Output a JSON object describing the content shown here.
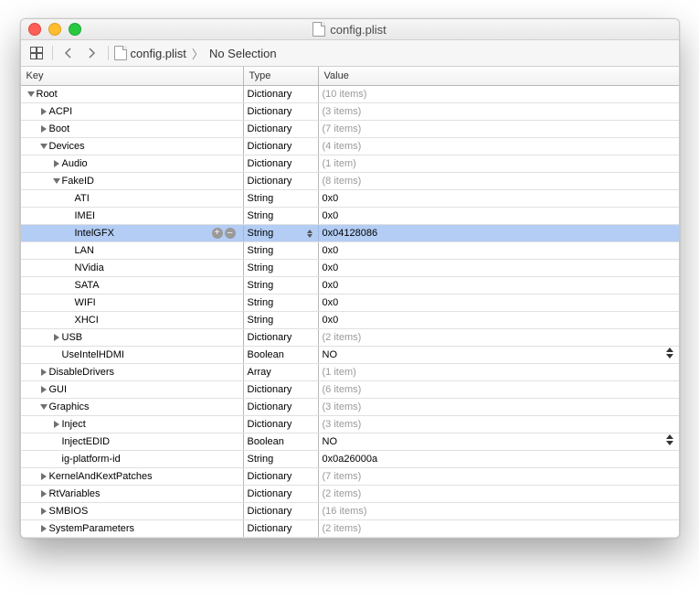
{
  "window": {
    "title": "config.plist"
  },
  "toolbar": {
    "breadcrumb_file": "config.plist",
    "breadcrumb_selection": "No Selection"
  },
  "headers": {
    "key": "Key",
    "type": "Type",
    "value": "Value"
  },
  "rows": [
    {
      "indent": 0,
      "disclosure": "down",
      "key": "Root",
      "type": "Dictionary",
      "value": "(10 items)",
      "muted": true
    },
    {
      "indent": 1,
      "disclosure": "right",
      "key": "ACPI",
      "type": "Dictionary",
      "value": "(3 items)",
      "muted": true
    },
    {
      "indent": 1,
      "disclosure": "right",
      "key": "Boot",
      "type": "Dictionary",
      "value": "(7 items)",
      "muted": true
    },
    {
      "indent": 1,
      "disclosure": "down",
      "key": "Devices",
      "type": "Dictionary",
      "value": "(4 items)",
      "muted": true
    },
    {
      "indent": 2,
      "disclosure": "right",
      "key": "Audio",
      "type": "Dictionary",
      "value": "(1 item)",
      "muted": true
    },
    {
      "indent": 2,
      "disclosure": "down",
      "key": "FakeID",
      "type": "Dictionary",
      "value": "(8 items)",
      "muted": true
    },
    {
      "indent": 3,
      "disclosure": "none",
      "key": "ATI",
      "type": "String",
      "value": "0x0"
    },
    {
      "indent": 3,
      "disclosure": "none",
      "key": "IMEI",
      "type": "String",
      "value": "0x0"
    },
    {
      "indent": 3,
      "disclosure": "none",
      "key": "IntelGFX",
      "type": "String",
      "value": "0x04128086",
      "selected": true,
      "type_arrows": true
    },
    {
      "indent": 3,
      "disclosure": "none",
      "key": "LAN",
      "type": "String",
      "value": "0x0"
    },
    {
      "indent": 3,
      "disclosure": "none",
      "key": "NVidia",
      "type": "String",
      "value": "0x0"
    },
    {
      "indent": 3,
      "disclosure": "none",
      "key": "SATA",
      "type": "String",
      "value": "0x0"
    },
    {
      "indent": 3,
      "disclosure": "none",
      "key": "WIFI",
      "type": "String",
      "value": "0x0"
    },
    {
      "indent": 3,
      "disclosure": "none",
      "key": "XHCI",
      "type": "String",
      "value": "0x0"
    },
    {
      "indent": 2,
      "disclosure": "right",
      "key": "USB",
      "type": "Dictionary",
      "value": "(2 items)",
      "muted": true
    },
    {
      "indent": 2,
      "disclosure": "none",
      "key": "UseIntelHDMI",
      "type": "Boolean",
      "value": "NO",
      "stepper": true
    },
    {
      "indent": 1,
      "disclosure": "right",
      "key": "DisableDrivers",
      "type": "Array",
      "value": "(1 item)",
      "muted": true
    },
    {
      "indent": 1,
      "disclosure": "right",
      "key": "GUI",
      "type": "Dictionary",
      "value": "(6 items)",
      "muted": true
    },
    {
      "indent": 1,
      "disclosure": "down",
      "key": "Graphics",
      "type": "Dictionary",
      "value": "(3 items)",
      "muted": true
    },
    {
      "indent": 2,
      "disclosure": "right",
      "key": "Inject",
      "type": "Dictionary",
      "value": "(3 items)",
      "muted": true
    },
    {
      "indent": 2,
      "disclosure": "none",
      "key": "InjectEDID",
      "type": "Boolean",
      "value": "NO",
      "stepper": true
    },
    {
      "indent": 2,
      "disclosure": "none",
      "key": "ig-platform-id",
      "type": "String",
      "value": "0x0a26000a"
    },
    {
      "indent": 1,
      "disclosure": "right",
      "key": "KernelAndKextPatches",
      "type": "Dictionary",
      "value": "(7 items)",
      "muted": true
    },
    {
      "indent": 1,
      "disclosure": "right",
      "key": "RtVariables",
      "type": "Dictionary",
      "value": "(2 items)",
      "muted": true
    },
    {
      "indent": 1,
      "disclosure": "right",
      "key": "SMBIOS",
      "type": "Dictionary",
      "value": "(16 items)",
      "muted": true
    },
    {
      "indent": 1,
      "disclosure": "right",
      "key": "SystemParameters",
      "type": "Dictionary",
      "value": "(2 items)",
      "muted": true
    }
  ]
}
